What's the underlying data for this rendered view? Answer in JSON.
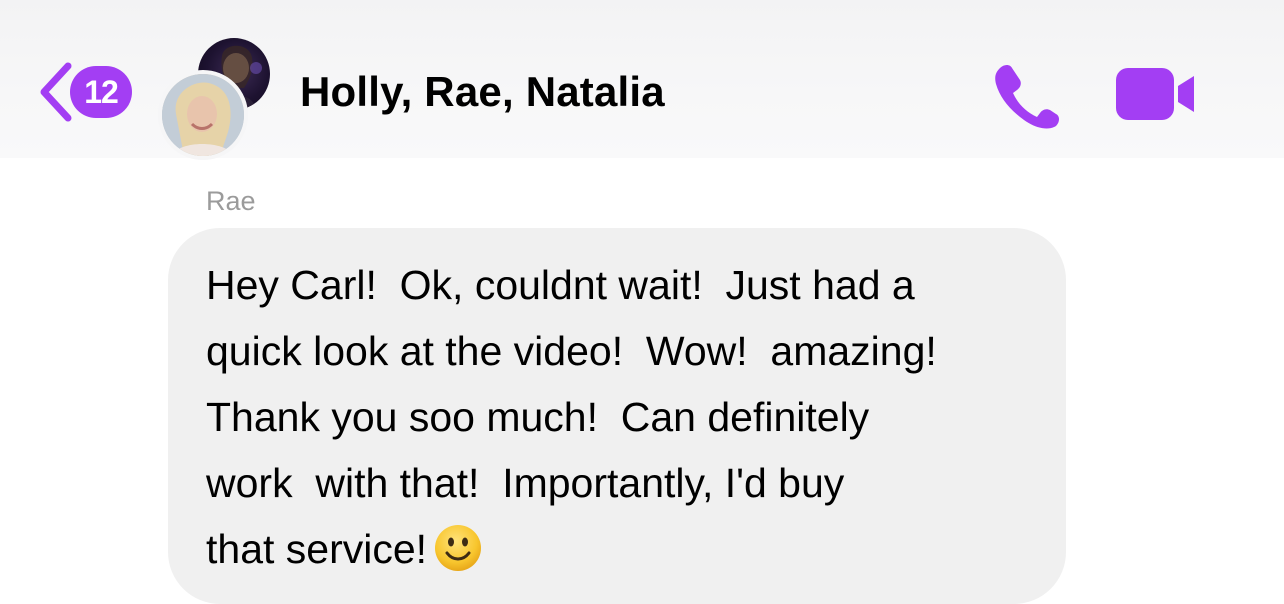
{
  "header": {
    "back_badge_count": "12",
    "title": "Holly, Rae, Natalia",
    "accent_color": "#a33ef3",
    "icons": {
      "back": "chevron-left-icon",
      "call": "phone-icon",
      "video": "video-camera-icon"
    }
  },
  "message": {
    "sender": "Rae",
    "lines": [
      "Hey Carl!  Ok, couldnt wait!  Just had a",
      "quick look at the video!  Wow!  amazing!",
      "Thank you soo much!  Can definitely",
      "work  with that!  Importantly, I'd buy",
      "that service!"
    ],
    "emoji": "slightly-smiling-face-emoji"
  }
}
